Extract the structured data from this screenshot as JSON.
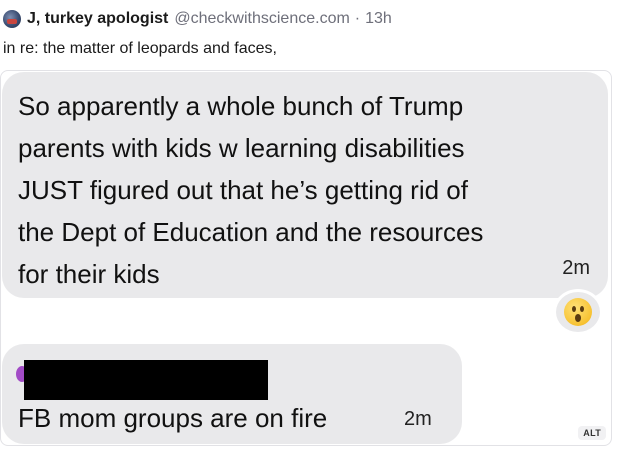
{
  "post": {
    "author": {
      "display_name": "J, turkey apologist",
      "handle": "@checkwithscience.com",
      "separator": "·",
      "age": "13h"
    },
    "text": "in re: the matter of leopards and faces,"
  },
  "media": {
    "messages": [
      {
        "text": "So apparently a whole bunch of Trump\nparents with kids w learning disabilities\nJUST figured out that he’s getting rid of\nthe Dept of Education and the resources\nfor their kids",
        "time": "2m",
        "reaction": "hushed-face-emoji"
      },
      {
        "text": "FB mom groups are on fire",
        "time": "2m",
        "redacted": true
      }
    ],
    "alt_badge": "ALT"
  },
  "colors": {
    "bubble": "#e9e9eb",
    "muted_text": "#6e6f7a",
    "redaction": "#000000"
  }
}
